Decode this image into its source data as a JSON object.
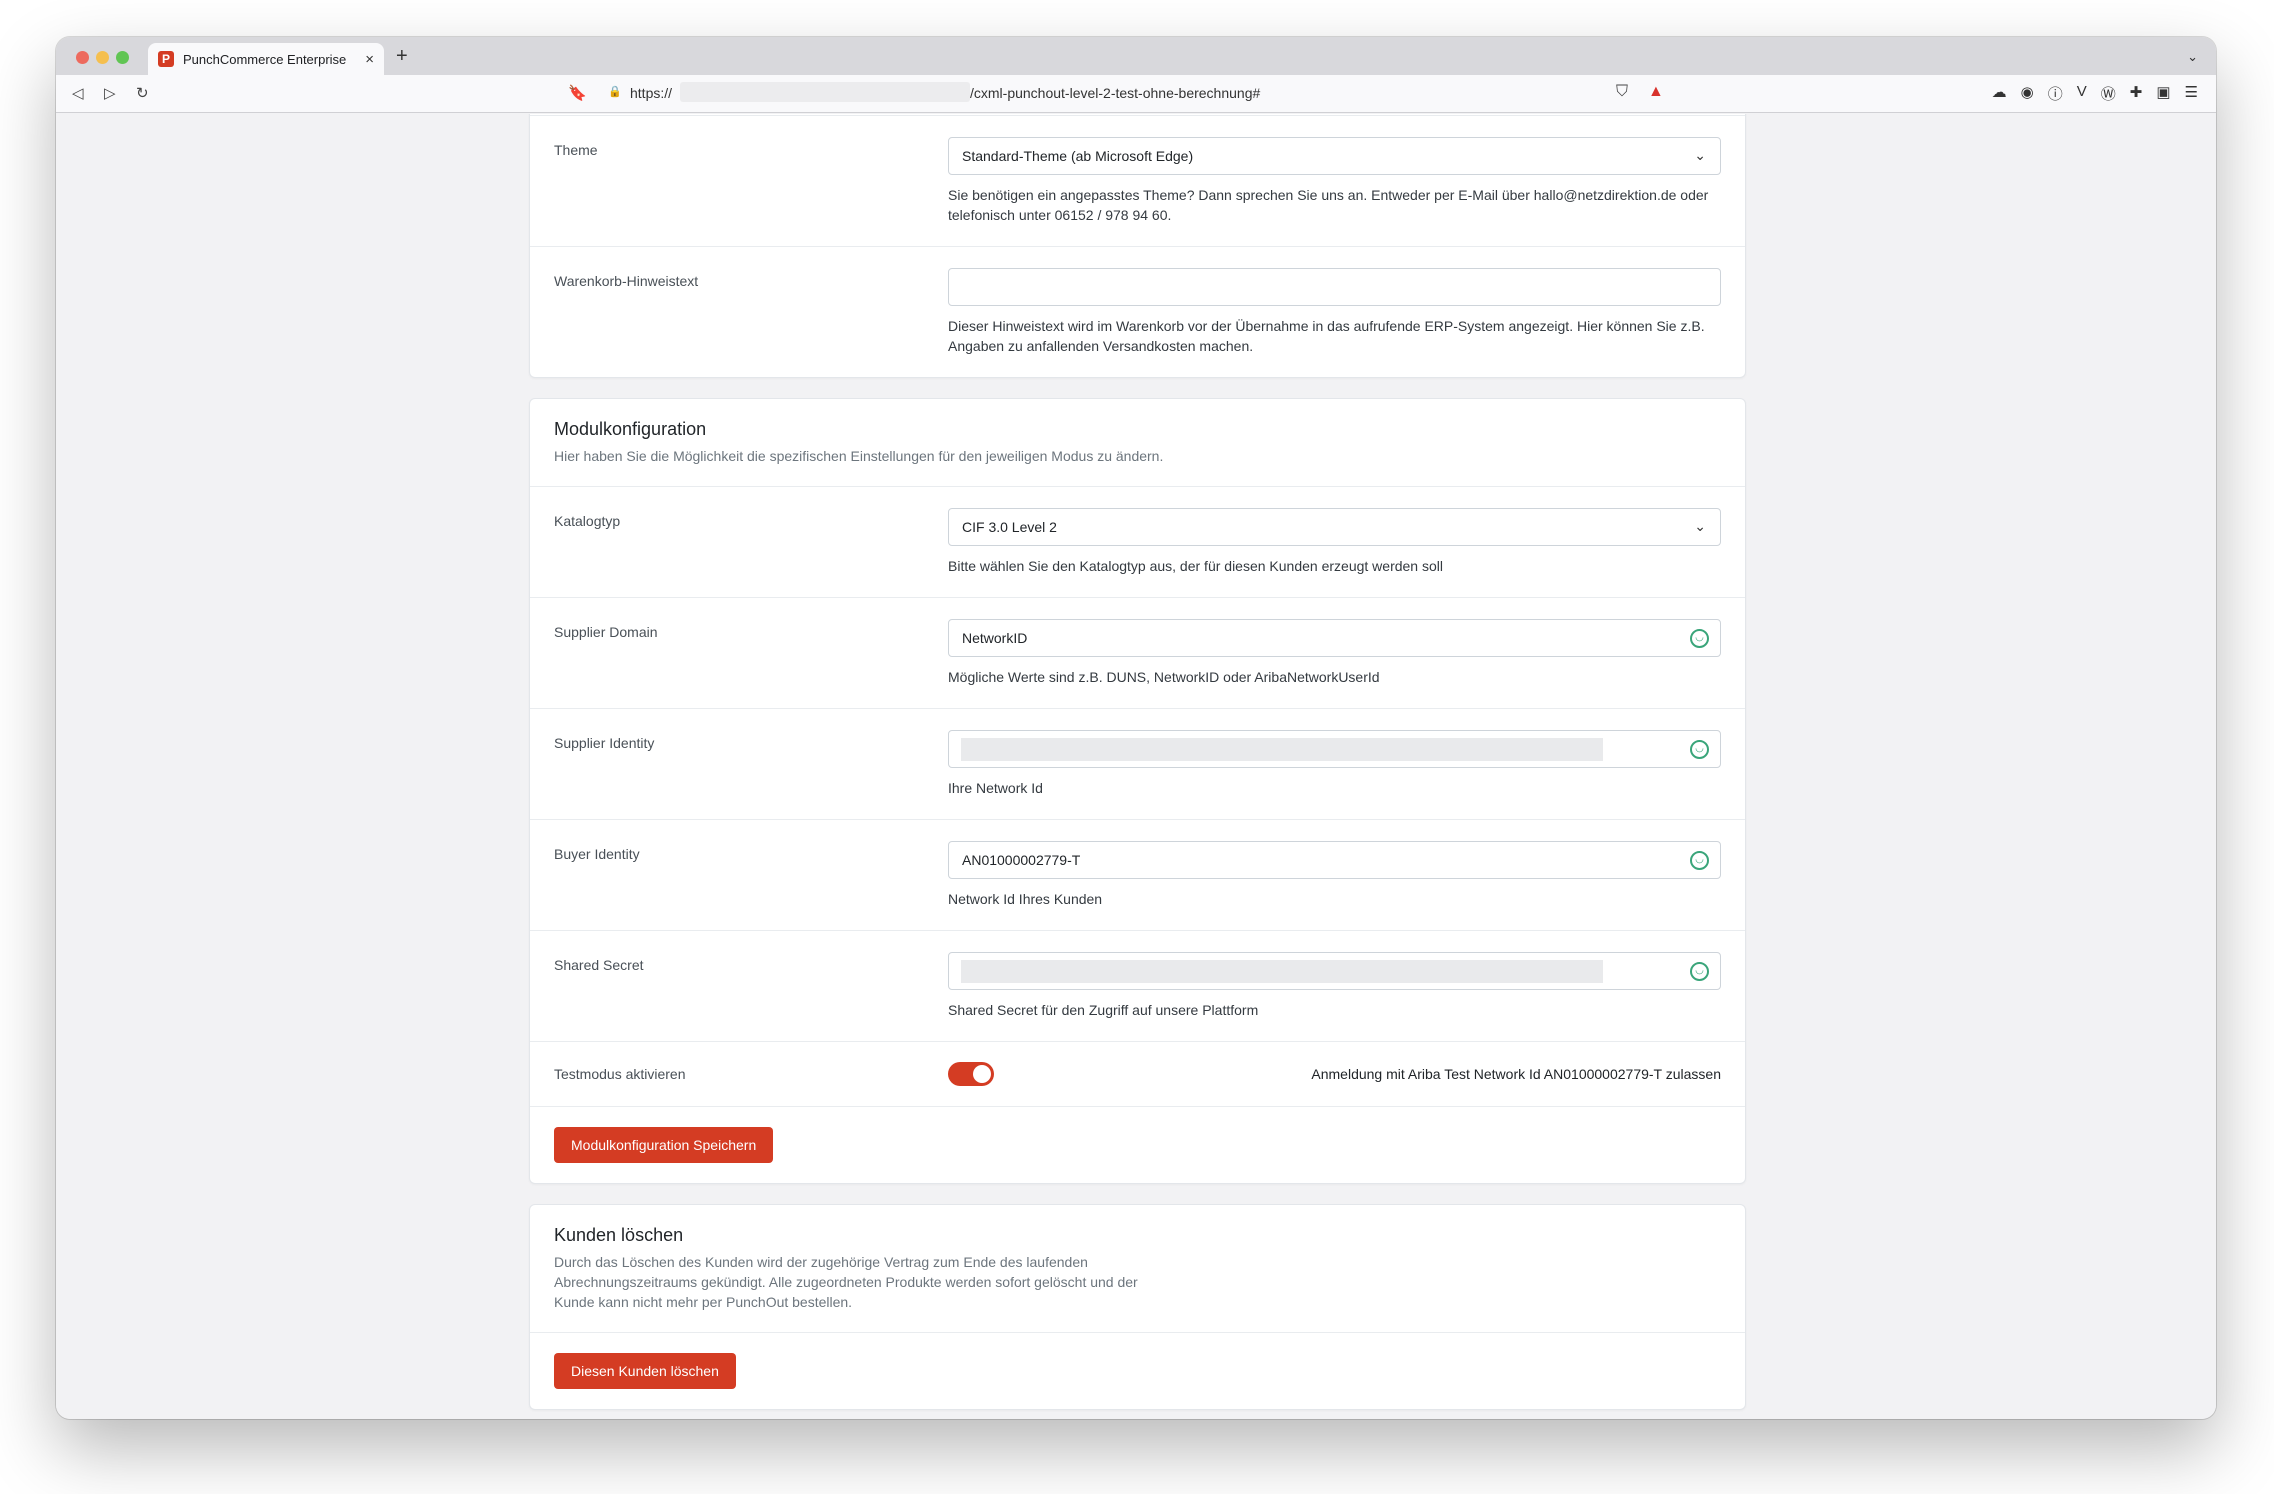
{
  "browser": {
    "tab_title": "PunchCommerce Enterprise",
    "favicon_letter": "P",
    "url_scheme": "https://",
    "url_path": "/cxml-punchout-level-2-test-ohne-berechnung#"
  },
  "general_settings": {
    "theme": {
      "label": "Theme",
      "value": "Standard-Theme (ab Microsoft Edge)",
      "help": "Sie benötigen ein angepasstes Theme? Dann sprechen Sie uns an. Entweder per E-Mail über hallo@netzdirektion.de oder telefonisch unter 06152 / 978 94 60."
    },
    "cart_note": {
      "label": "Warenkorb-Hinweistext",
      "value": "",
      "help": "Dieser Hinweistext wird im Warenkorb vor der Übernahme in das aufrufende ERP-System angezeigt. Hier können Sie z.B. Angaben zu anfallenden Versandkosten machen."
    }
  },
  "module_config": {
    "title": "Modulkonfiguration",
    "subtitle": "Hier haben Sie die Möglichkeit die spezifischen Einstellungen für den jeweiligen Modus zu ändern.",
    "catalog_type": {
      "label": "Katalogtyp",
      "value": "CIF 3.0 Level 2",
      "help": "Bitte wählen Sie den Katalogtyp aus, der für diesen Kunden erzeugt werden soll"
    },
    "supplier_domain": {
      "label": "Supplier Domain",
      "value": "NetworkID",
      "help": "Mögliche Werte sind z.B. DUNS, NetworkID oder AribaNetworkUserId"
    },
    "supplier_identity": {
      "label": "Supplier Identity",
      "help": "Ihre Network Id"
    },
    "buyer_identity": {
      "label": "Buyer Identity",
      "value": "AN01000002779-T",
      "help": "Network Id Ihres Kunden"
    },
    "shared_secret": {
      "label": "Shared Secret",
      "help": "Shared Secret für den Zugriff auf unsere Plattform"
    },
    "test_mode": {
      "label": "Testmodus aktivieren",
      "enabled": true,
      "text": "Anmeldung mit Ariba Test Network Id AN01000002779-T zulassen"
    },
    "save_label": "Modulkonfiguration Speichern"
  },
  "delete_customer": {
    "title": "Kunden löschen",
    "description_lines": [
      "Durch das Löschen des Kunden wird der zugehörige Vertrag zum Ende des laufenden",
      "Abrechnungszeitraums gekündigt. Alle zugeordneten Produkte werden sofort gelöscht und der",
      "Kunde kann nicht mehr per PunchOut bestellen."
    ],
    "button_label": "Diesen Kunden löschen"
  },
  "colors": {
    "accent": "#d43c23",
    "valid": "#3aa57a"
  }
}
